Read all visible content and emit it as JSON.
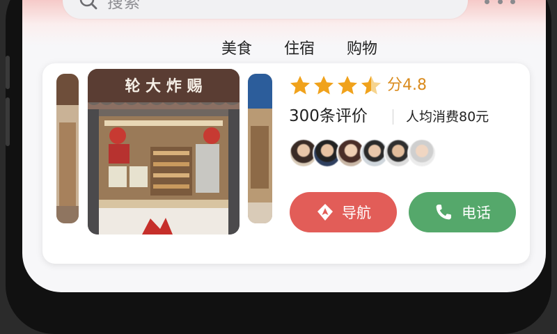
{
  "search": {
    "placeholder": "搜索"
  },
  "tabs": [
    {
      "label": "美食",
      "active": true
    },
    {
      "label": "住宿",
      "active": false
    },
    {
      "label": "购物",
      "active": false
    }
  ],
  "shop": {
    "gallery_main_sign": "轮 大 炸 赐",
    "rating": {
      "stars": 4.5,
      "text": "分4.8"
    },
    "review_count": "300条评价",
    "avg_price": "人均消费80元",
    "avatars_count": 6
  },
  "actions": {
    "navigate_label": "导航",
    "call_label": "电话"
  },
  "colors": {
    "accent_red": "#e25d58",
    "accent_green": "#55a86b",
    "star": "#f0a21c",
    "rating_text": "#d98a1c"
  },
  "icons": [
    "search-icon",
    "more-icon",
    "star-icon",
    "navigation-icon",
    "phone-icon"
  ]
}
